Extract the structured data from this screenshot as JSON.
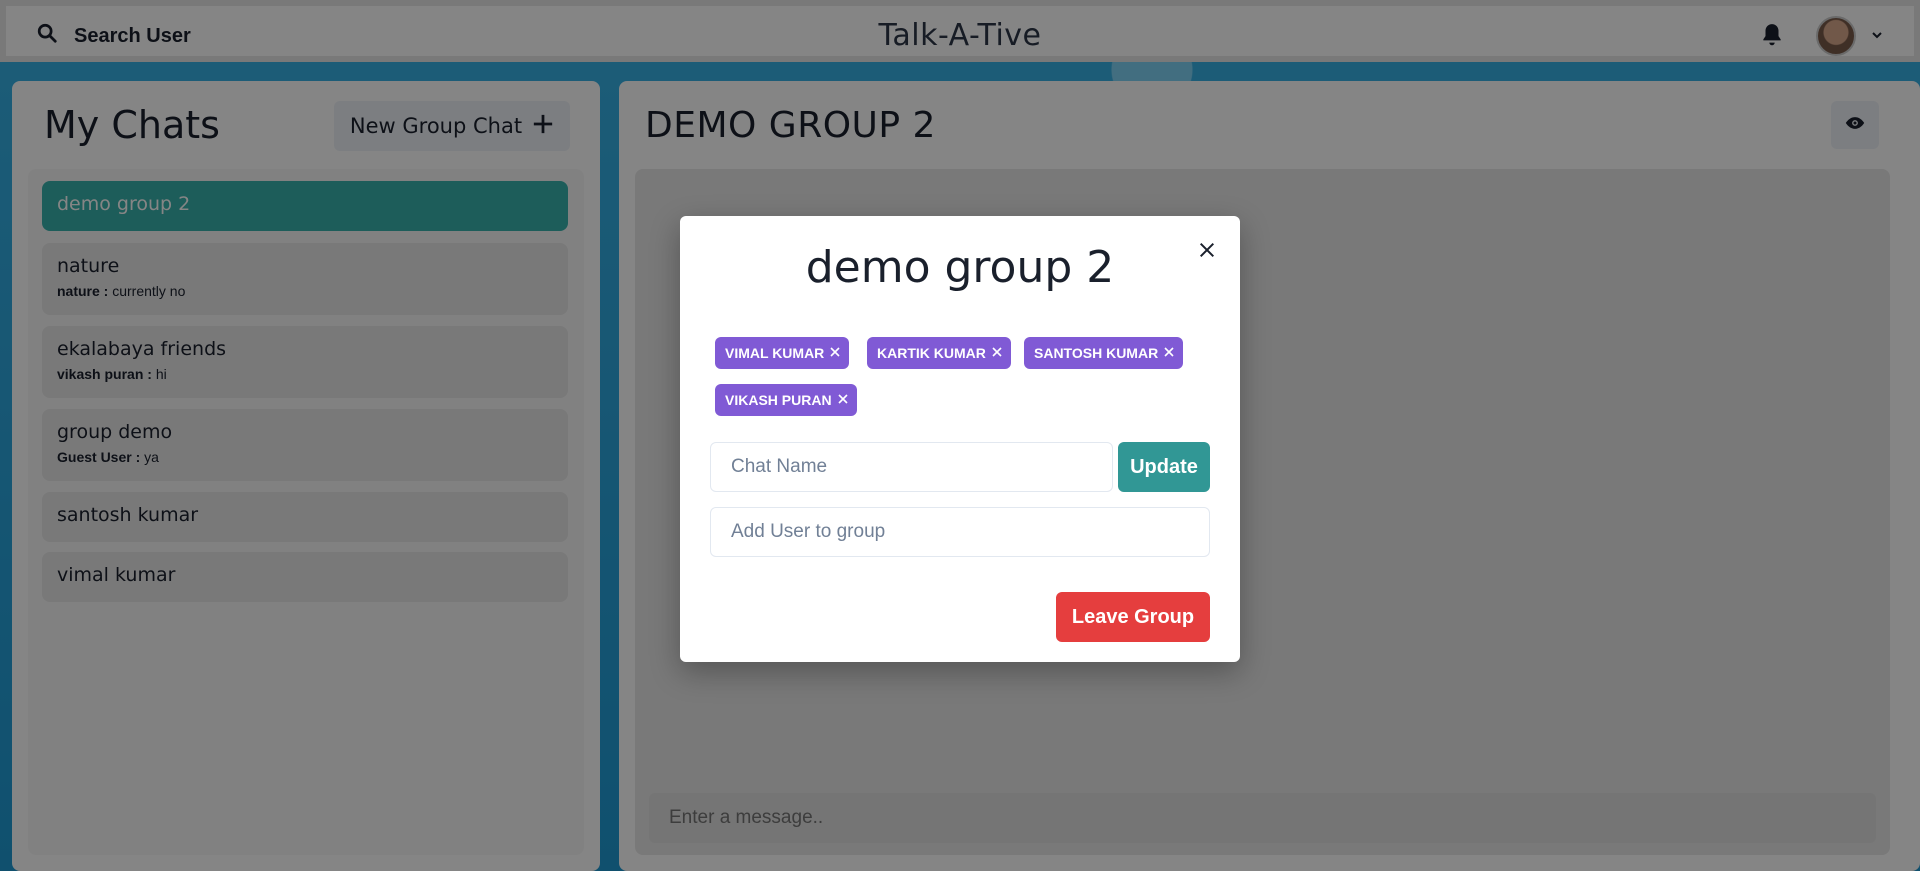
{
  "header": {
    "search_label": "Search User",
    "app_title": "Talk-A-Tive"
  },
  "sidebar": {
    "title": "My Chats",
    "new_group_label": "New Group Chat",
    "chats": [
      {
        "name": "demo group 2",
        "sender": "",
        "message": "",
        "active": true
      },
      {
        "name": "nature",
        "sender": "nature :",
        "message": "currently no",
        "active": false
      },
      {
        "name": "ekalabaya friends",
        "sender": "vikash puran :",
        "message": "hi",
        "active": false
      },
      {
        "name": "group demo",
        "sender": "Guest User :",
        "message": "ya",
        "active": false
      },
      {
        "name": "santosh kumar",
        "sender": "",
        "message": "",
        "active": false
      },
      {
        "name": "vimal kumar",
        "sender": "",
        "message": "",
        "active": false
      }
    ]
  },
  "chat_panel": {
    "title": "DEMO GROUP 2",
    "message_placeholder": "Enter a message.."
  },
  "modal": {
    "title": "demo group 2",
    "members": [
      "VIMAL KUMAR",
      "KARTIK KUMAR",
      "SANTOSH KUMAR",
      "VIKASH PURAN"
    ],
    "chat_name_placeholder": "Chat Name",
    "update_label": "Update",
    "add_user_placeholder": "Add User to group",
    "leave_label": "Leave Group"
  },
  "colors": {
    "accent_teal": "#38b2ac",
    "badge_purple": "#805ad5",
    "danger_red": "#e53e3e"
  }
}
